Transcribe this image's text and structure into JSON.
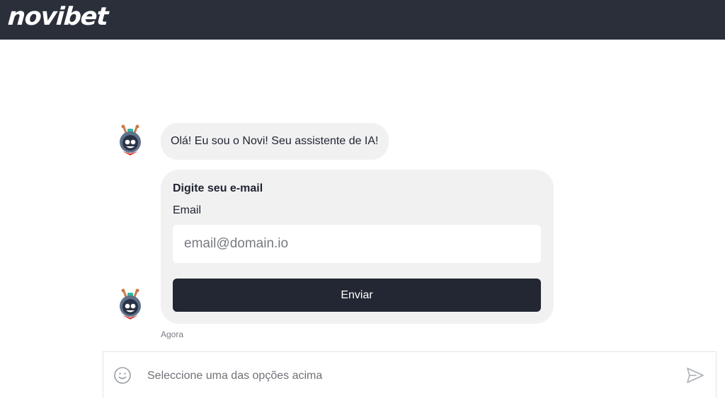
{
  "header": {
    "logo_text": "novibet"
  },
  "chat": {
    "greeting": "Olá! Eu sou o Novi! Seu assistente de IA!",
    "form": {
      "title": "Digite seu e-mail",
      "email_label": "Email",
      "email_placeholder": "email@domain.io",
      "email_value": "",
      "submit_label": "Enviar"
    },
    "timestamp": "Agora"
  },
  "composer": {
    "placeholder": "Seleccione uma das opções acima",
    "emoji_icon": "smiley-icon",
    "send_icon": "paper-plane-icon"
  },
  "colors": {
    "header_bg": "#2b2f3a",
    "bubble_bg": "#f1f1f2",
    "button_bg": "#222733",
    "avatar_accent": "#d8443a"
  }
}
